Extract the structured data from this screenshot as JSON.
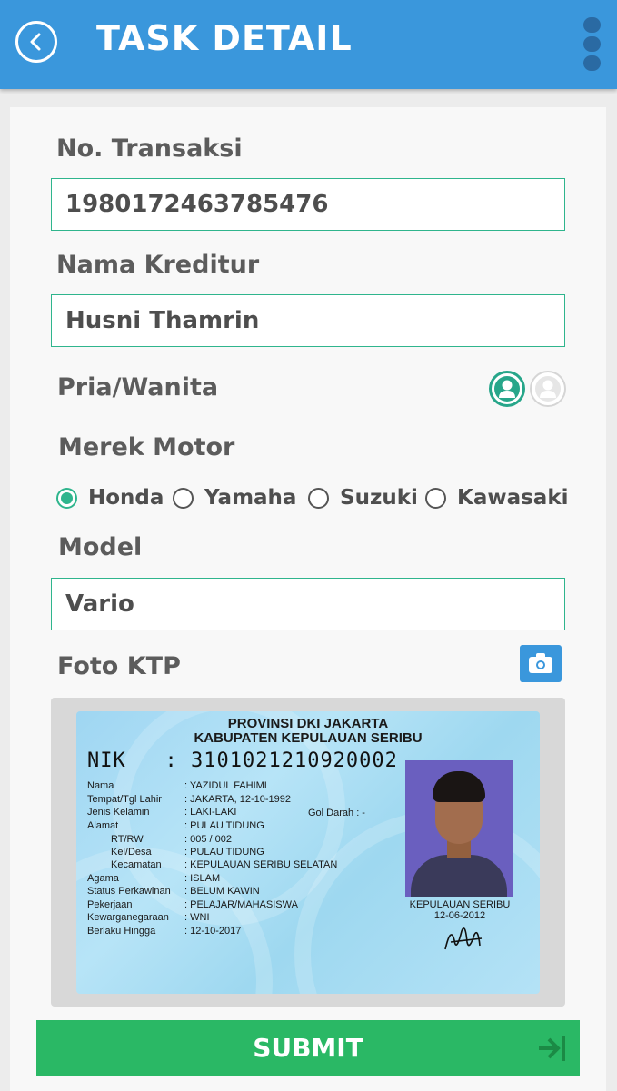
{
  "appbar": {
    "title": "TASK DETAIL"
  },
  "form": {
    "transaksi": {
      "label": "No. Transaksi",
      "value": "1980172463785476"
    },
    "kreditur": {
      "label": "Nama Kreditur",
      "value": "Husni Thamrin"
    },
    "gender": {
      "label": "Pria/Wanita",
      "selected": "pria"
    },
    "merek": {
      "label": "Merek Motor",
      "options": [
        "Honda",
        "Yamaha",
        "Suzuki",
        "Kawasaki"
      ],
      "selected": "Honda"
    },
    "model": {
      "label": "Model",
      "value": "Vario"
    },
    "foto": {
      "label": "Foto KTP"
    }
  },
  "ktp": {
    "provinsi": "PROVINSI DKI JAKARTA",
    "kabupaten": "KABUPATEN KEPULAUAN SERIBU",
    "nik_label": "NIK",
    "nik": ": 3101021210920002",
    "rows": [
      {
        "k": "Nama",
        "v": ": YAZIDUL FAHIMI"
      },
      {
        "k": "Tempat/Tgl Lahir",
        "v": ": JAKARTA, 12-10-1992"
      },
      {
        "k": "Jenis Kelamin",
        "v": ": LAKI-LAKI"
      },
      {
        "k": "Alamat",
        "v": ": PULAU TIDUNG"
      },
      {
        "k": "RT/RW",
        "v": ": 005 / 002"
      },
      {
        "k": "Kel/Desa",
        "v": ": PULAU TIDUNG"
      },
      {
        "k": "Kecamatan",
        "v": ": KEPULAUAN SERIBU SELATAN"
      },
      {
        "k": "Agama",
        "v": ": ISLAM"
      },
      {
        "k": "Status Perkawinan",
        "v": ": BELUM KAWIN"
      },
      {
        "k": "Pekerjaan",
        "v": ": PELAJAR/MAHASISWA"
      },
      {
        "k": "Kewarganegaraan",
        "v": ": WNI"
      },
      {
        "k": "Berlaku Hingga",
        "v": ": 12-10-2017"
      }
    ],
    "gol_darah": "Gol Darah   : -",
    "issue_place": "KEPULAUAN SERIBU",
    "issue_date": "12-06-2012"
  },
  "submit": {
    "label": "SUBMIT"
  },
  "colors": {
    "primary": "#3a97dc",
    "accent": "#2fb58d",
    "submit": "#2ab865"
  },
  "icons": [
    "back-icon",
    "more-vert-icon",
    "male-avatar-icon",
    "female-avatar-icon",
    "camera-icon",
    "submit-arrow-icon"
  ]
}
